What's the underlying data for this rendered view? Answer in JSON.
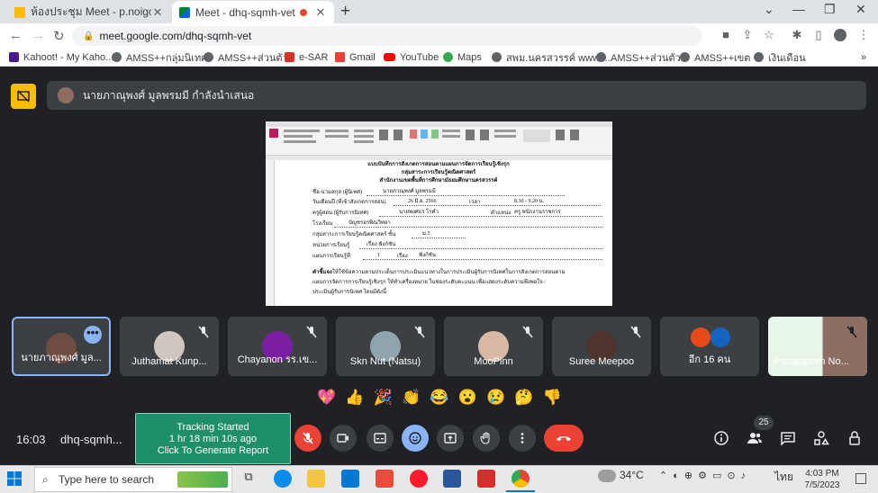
{
  "browser": {
    "tabs": [
      {
        "title": "ห้องประชุม Meet - p.noigor@gmail"
      },
      {
        "title": "Meet - dhq-sqmh-vet"
      }
    ],
    "url": "meet.google.com/dhq-sqmh-vet",
    "bookmarks": [
      "Kahoot! - My Kaho...",
      "AMSS++กลุ่มนิเทศ",
      "AMSS++ส่วนตัว",
      "e-SAR",
      "Gmail",
      "YouTube",
      "Maps",
      "สพม.นครสวรรค์ www....",
      "AMSS++ส่วนตัว",
      "AMSS++เขต",
      "เงินเดือน"
    ]
  },
  "meet": {
    "presenting_banner": "นายภาณุพงศ์ มูลพรมมี กำลังนำเสนอ",
    "document": {
      "heading1": "แบบบันทึกการสังเกตการสอนตามแผนการจัดการเรียนรู้เชิงรุก",
      "heading2": "กลุ่มสาระการเรียนรู้คณิตศาสตร์",
      "heading3": "สำนักงานเขตพื้นที่การศึกษามัธยมศึกษานครสวรรค์",
      "rows": [
        {
          "label": "ชื่อ-นามสกุล  (ผู้นิเทศ)",
          "value": "นายภาณุพงศ์  มูลพรมมี"
        },
        {
          "label": "วันเดือนปี (ที่เข้าสังเกตการสอน)",
          "value": "26 มิ.ย. 2566",
          "extra_label": "เวลา",
          "extra_value": "8.30 - 9.20 น."
        },
        {
          "label": "ครูผู้สอน (ผู้รับการนิเทศ)",
          "value": "นายพงศธร  โรคำ",
          "extra_label": "ตำแหน่ง",
          "extra_value": "ครู พนักงานราชการ"
        },
        {
          "label": "โรงเรียน",
          "value": "บัญชรอรพิณวิทยา"
        },
        {
          "label": "กลุ่มสาระการเรียนรู้คณิตศาสตร์ ชั้น",
          "value": "ม.5"
        },
        {
          "label": "หน่วยการเรียนรู้",
          "value": "เรื่อง ฟังก์ชัน"
        },
        {
          "label": "แผนการเรียนรู้ที่",
          "value": "1",
          "extra_label": "เรื่อง",
          "extra_value": "ฟังก์ชัน"
        }
      ],
      "instructions_label": "คำชี้แจง",
      "instructions": [
        "ให้ใช้ข้อความตามประเด็นการประเมินแนวทางในการประเมินผู้รับการนิเทศในการสังเกตการสอนตาม",
        "แผนการจัดการการเรียนรู้เชิงรุก ให้ทำเครื่องหมาย ในช่องระดับคะแนน เพื่อแสดงระดับความพึงพอใจ /",
        "ประเมินผู้รับการนิเทศ โดยมีดังนี้"
      ]
    },
    "participants": [
      {
        "name": "นายภาณุพงศ์ มูล..."
      },
      {
        "name": "Juthamat Kunp..."
      },
      {
        "name": "Chayanon รร.เข..."
      },
      {
        "name": "Skn Nut (Natsu)"
      },
      {
        "name": "MooPinn"
      },
      {
        "name": "Suree Meepoo"
      },
      {
        "name": "อีก 16 คน"
      },
      {
        "name": "Pattaraporn No..."
      }
    ],
    "reactions": [
      "💖",
      "👍",
      "🎉",
      "👏",
      "😂",
      "😮",
      "😢",
      "🤔",
      "👎"
    ],
    "time": "16:03",
    "meeting_code": "dhq-sqmh...",
    "tracking": {
      "line1": "Tracking Started",
      "line2": "1 hr 18 min 10s ago",
      "line3": "Click To Generate Report"
    },
    "people_count": "25"
  },
  "taskbar": {
    "search_placeholder": "Type here to search",
    "weather": "34°C",
    "language": "ไทย",
    "time": "4:03 PM",
    "date": "7/5/2023"
  },
  "colors": {
    "meet_bg": "#202124",
    "tile_bg": "#3c4043",
    "end_call": "#ea4335",
    "accent": "#8ab4f8",
    "tracking": "#1e8e6b",
    "presenting_icon": "#fbbc04"
  }
}
